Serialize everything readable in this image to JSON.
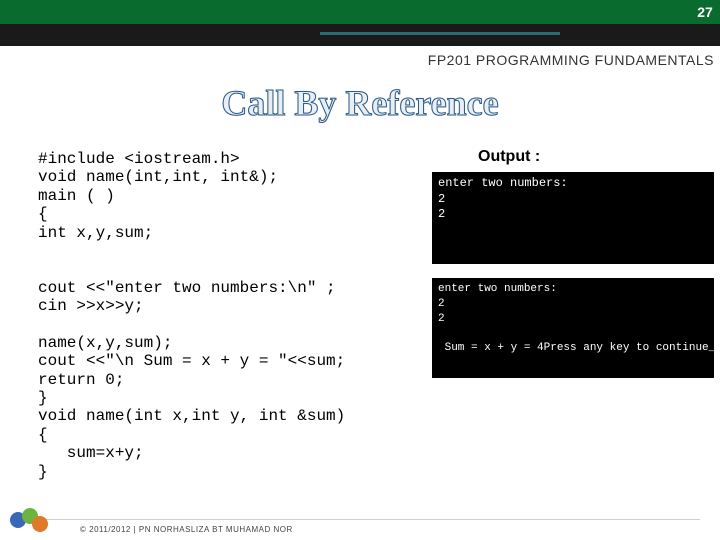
{
  "page_number": "27",
  "course": "FP201 PROGRAMMING FUNDAMENTALS",
  "title": "Call By Reference",
  "code": "#include <iostream.h>\nvoid name(int,int, int&);\nmain ( )\n{\nint x,y,sum;\n\n\ncout <<\"enter two numbers:\\n\" ;\ncin >>x>>y;\n\nname(x,y,sum);\ncout <<\"\\n Sum = x + y = \"<<sum;\nreturn 0;\n}\nvoid name(int x,int y, int &sum)\n{\n   sum=x+y;\n}",
  "output_label": "Output :",
  "terminal1": "enter two numbers:\n2\n2",
  "terminal2": "enter two numbers:\n2\n2\n\n Sum = x + y = 4Press any key to continue_",
  "footer": "© 2011/2012 | PN NORHASLIZA BT MUHAMAD NOR",
  "logo_alt": "institution-logo"
}
